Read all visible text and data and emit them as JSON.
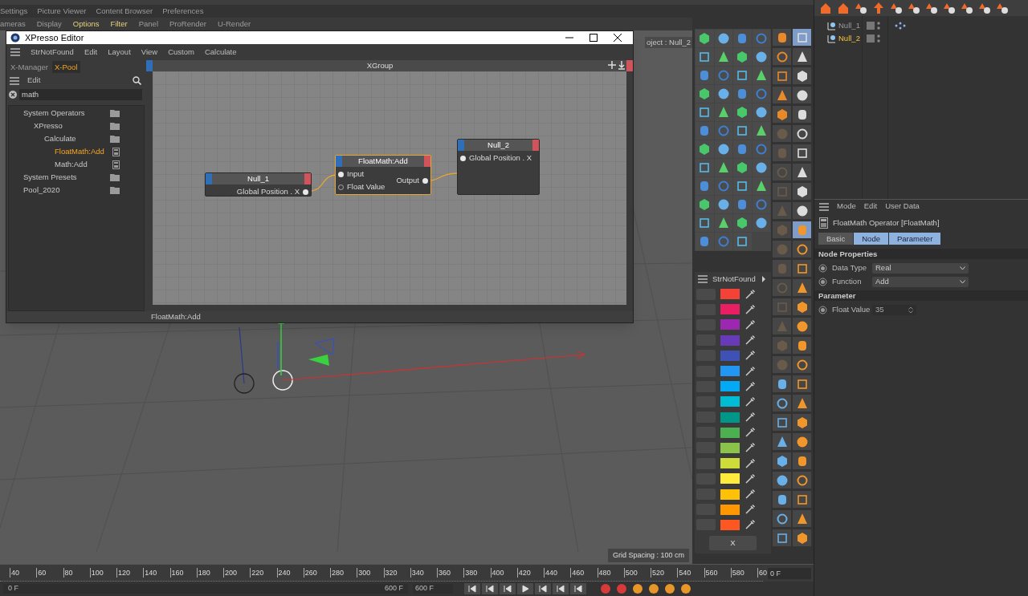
{
  "top_menu": [
    "Settings",
    "Picture Viewer",
    "Content Browser",
    "Preferences"
  ],
  "viewport_menu": [
    {
      "label": "ameras",
      "highlighted": false
    },
    {
      "label": "Display",
      "highlighted": false
    },
    {
      "label": "Options",
      "highlighted": true
    },
    {
      "label": "Filter",
      "highlighted": true
    },
    {
      "label": "Panel",
      "highlighted": false
    },
    {
      "label": "ProRender",
      "highlighted": false
    },
    {
      "label": "U-Render",
      "highlighted": false
    }
  ],
  "viewport": {
    "camera_label": "oject : Null_2",
    "grid_spacing": "Grid Spacing : 100 cm"
  },
  "xpresso": {
    "title": "XPresso Editor",
    "menu": [
      "StrNotFound",
      "Edit",
      "Layout",
      "View",
      "Custom",
      "Calculate"
    ],
    "tabs": [
      {
        "label": "X-Manager",
        "selected": false
      },
      {
        "label": "X-Pool",
        "selected": true
      }
    ],
    "pool_menu": "Edit",
    "search": {
      "value": "math"
    },
    "tree": [
      {
        "label": "System Operators",
        "selected": false,
        "kind": "folder",
        "children": [
          {
            "label": "XPresso",
            "selected": false,
            "kind": "folder",
            "children": [
              {
                "label": "Calculate",
                "selected": false,
                "kind": "folder",
                "children": [
                  {
                    "label": "FloatMath:Add",
                    "selected": true,
                    "kind": "operator"
                  },
                  {
                    "label": "Math:Add",
                    "selected": false,
                    "kind": "operator"
                  }
                ]
              }
            ]
          }
        ]
      },
      {
        "label": "System Presets",
        "selected": false,
        "kind": "folder"
      },
      {
        "label": "Pool_2020",
        "selected": false,
        "kind": "folder"
      }
    ],
    "graph": {
      "title": "XGroup",
      "nodes": [
        {
          "title": "Null_1",
          "selected": false,
          "ports": [
            {
              "label": "Global Position . X",
              "kind": "output",
              "connected": true
            }
          ]
        },
        {
          "title": "FloatMath:Add",
          "selected": true,
          "ports": [
            {
              "label": "Input",
              "kind": "input",
              "connected": true
            },
            {
              "label": "Float Value",
              "kind": "input",
              "connected": false
            },
            {
              "label": "Output",
              "kind": "output",
              "connected": true
            }
          ]
        },
        {
          "title": "Null_2",
          "selected": false,
          "ports": [
            {
              "label": "Global Position . X",
              "kind": "input",
              "connected": true
            }
          ]
        }
      ]
    },
    "status": "FloatMath:Add"
  },
  "palette": {
    "title": "StrNotFound",
    "swatches": [
      {
        "color": "#f44336"
      },
      {
        "color": "#e91e63"
      },
      {
        "color": "#9c27b0"
      },
      {
        "color": "#673ab7"
      },
      {
        "color": "#3f51b5"
      },
      {
        "color": "#2196f3"
      },
      {
        "color": "#03a9f4"
      },
      {
        "color": "#00bcd4"
      },
      {
        "color": "#009688"
      },
      {
        "color": "#4caf50"
      },
      {
        "color": "#8bc34a"
      },
      {
        "color": "#cddc39"
      },
      {
        "color": "#ffeb3b"
      },
      {
        "color": "#ffc107"
      },
      {
        "color": "#ff9800"
      },
      {
        "color": "#ff5722"
      }
    ],
    "button": "X"
  },
  "timeline": {
    "ticks": [
      "40",
      "60",
      "80",
      "100",
      "120",
      "140",
      "160",
      "180",
      "200",
      "220",
      "240",
      "260",
      "280",
      "300",
      "320",
      "340",
      "360",
      "380",
      "400",
      "420",
      "440",
      "460",
      "480",
      "500",
      "520",
      "540",
      "560",
      "580",
      "60"
    ],
    "frame_field": "0 F",
    "start": "0 F",
    "end": "600 F",
    "end_field": "600 F"
  },
  "object_manager": {
    "objects": [
      {
        "name": "Null_1",
        "selected": false
      },
      {
        "name": "Null_2",
        "selected": true
      }
    ]
  },
  "attributes": {
    "menu": [
      "Mode",
      "Edit",
      "User Data"
    ],
    "title": "FloatMath Operator [FloatMath]",
    "tabs": [
      {
        "label": "Basic",
        "selected": false
      },
      {
        "label": "Node",
        "selected": true
      },
      {
        "label": "Parameter",
        "selected": true
      }
    ],
    "sections": [
      {
        "title": "Node Properties",
        "fields": [
          {
            "label": "Data Type",
            "kind": "dropdown",
            "value": "Real"
          },
          {
            "label": "Function",
            "kind": "dropdown",
            "value": "Add"
          }
        ]
      },
      {
        "title": "Parameter",
        "fields": [
          {
            "label": "Float Value",
            "kind": "number",
            "value": "35"
          }
        ]
      }
    ]
  }
}
